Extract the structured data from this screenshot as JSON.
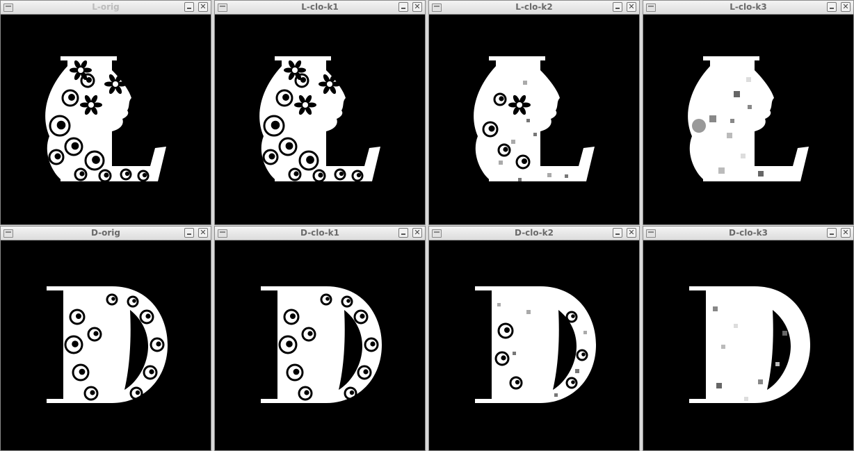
{
  "windows": [
    {
      "title": "L-orig",
      "letter": "L",
      "variant": "orig"
    },
    {
      "title": "L-clo-k1",
      "letter": "L",
      "variant": "k1"
    },
    {
      "title": "L-clo-k2",
      "letter": "L",
      "variant": "k2"
    },
    {
      "title": "L-clo-k3",
      "letter": "L",
      "variant": "k3"
    },
    {
      "title": "D-orig",
      "letter": "D",
      "variant": "orig"
    },
    {
      "title": "D-clo-k1",
      "letter": "D",
      "variant": "k1"
    },
    {
      "title": "D-clo-k2",
      "letter": "D",
      "variant": "k2"
    },
    {
      "title": "D-clo-k3",
      "letter": "D",
      "variant": "k3"
    }
  ],
  "close_glyph": "✕",
  "colors": {
    "image_bg": "#000000",
    "foreground": "#ffffff"
  }
}
